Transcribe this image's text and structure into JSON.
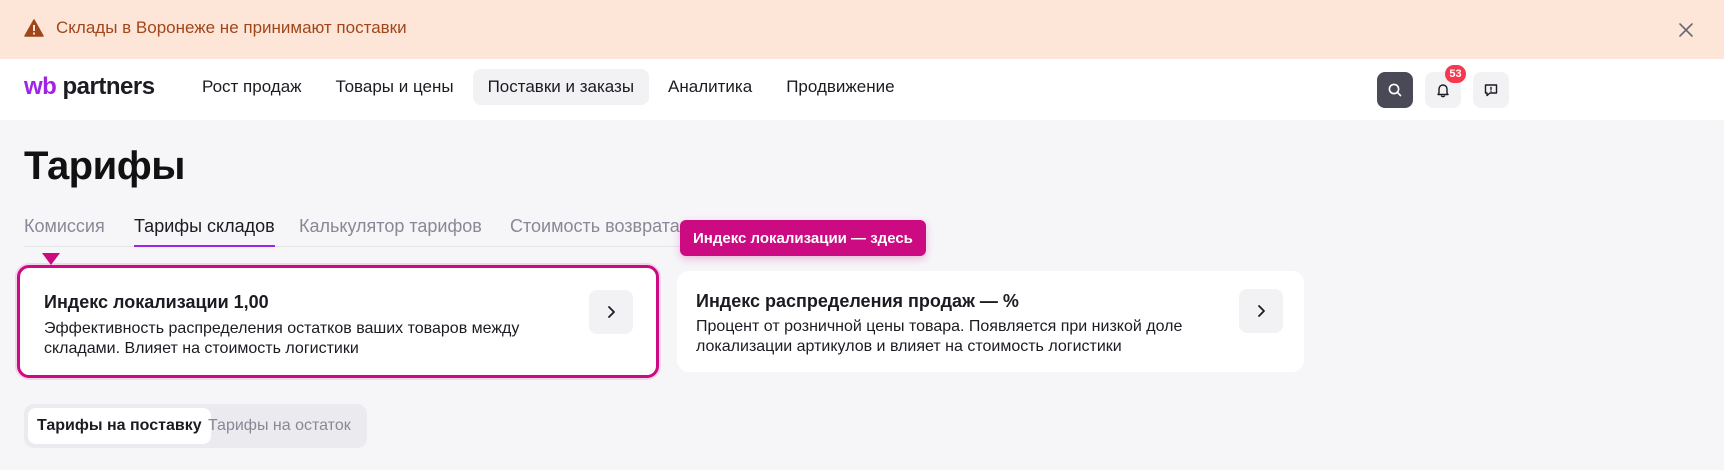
{
  "banner": {
    "text": "Склады в Воронеже не принимают поставки",
    "warning_icon": "warning-triangle-icon",
    "close_icon": "close-icon"
  },
  "header": {
    "logo_wb": "wb",
    "logo_partners": "partners",
    "nav": [
      {
        "label": "Рост продаж"
      },
      {
        "label": "Товары и цены"
      },
      {
        "label": "Поставки и заказы",
        "active": true
      },
      {
        "label": "Аналитика"
      },
      {
        "label": "Продвижение"
      }
    ],
    "notifications_count": "53"
  },
  "page": {
    "title": "Тарифы",
    "tabs": [
      {
        "label": "Комиссия"
      },
      {
        "label": "Тарифы складов",
        "active": true
      },
      {
        "label": "Калькулятор тарифов"
      },
      {
        "label": "Стоимость возврата"
      }
    ],
    "tooltip": "Индекс локализации — здесь"
  },
  "cards": [
    {
      "title": "Индекс локализации 1,00",
      "description": "Эффективность распределения остатков ваших товаров между складами. Влияет на стоимость логистики"
    },
    {
      "title": "Индекс распределения продаж  — %",
      "description": "Процент от розничной цены товара. Появляется при низкой доле локализации артикулов и влияет на стоимость логистики"
    }
  ],
  "segments": [
    {
      "label": "Тарифы на поставку",
      "active": true
    },
    {
      "label": "Тарифы на остаток"
    }
  ],
  "colors": {
    "brand": "#a024e6",
    "highlight": "#cc0a82",
    "banner_bg": "#fde6d8",
    "banner_text": "#a0461a",
    "badge": "#f5384e"
  }
}
